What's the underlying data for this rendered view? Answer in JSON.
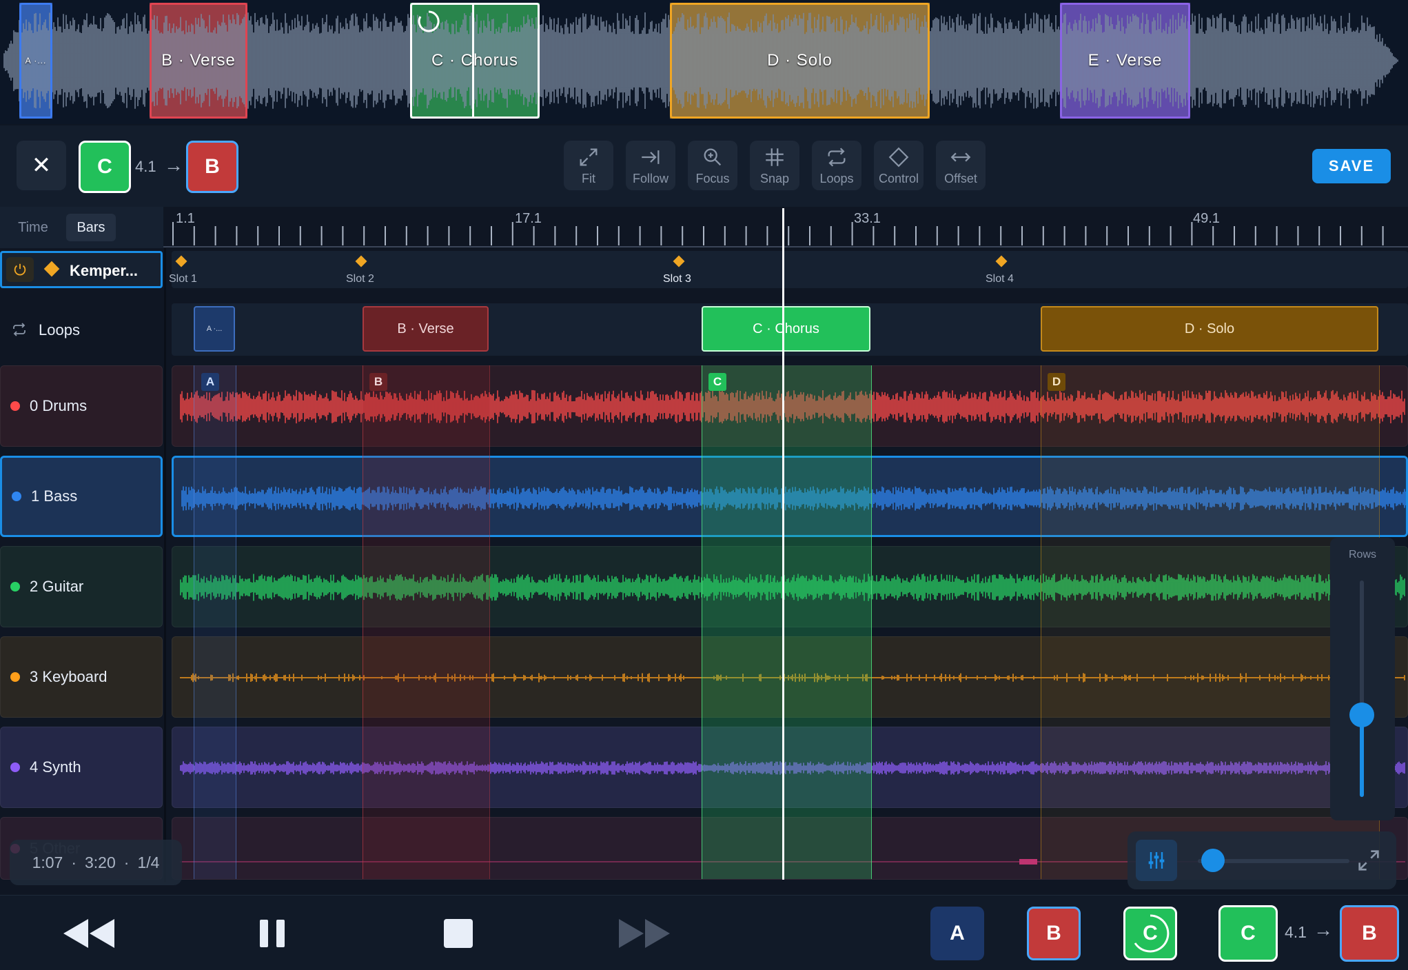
{
  "overview": {
    "sections": [
      {
        "label": "A ·...",
        "color": "#3b6fd1",
        "border": "#3d7bf0"
      },
      {
        "label": "B · Verse",
        "color": "#b8444d",
        "border": "#e04451"
      },
      {
        "label": "C · Chorus",
        "color": "#2f9d55",
        "border": "#ffffff"
      },
      {
        "label": "D · Solo",
        "color": "#b2893e",
        "border": "#f0a623"
      },
      {
        "label": "E · Verse",
        "color": "#7458c9",
        "border": "#8a63e6"
      }
    ]
  },
  "toolbar": {
    "close_label": "✕",
    "current_section": "C",
    "position": "4.1",
    "next_section": "B",
    "tools": [
      {
        "label": "Fit",
        "icon": "expand-icon"
      },
      {
        "label": "Follow",
        "icon": "follow-icon"
      },
      {
        "label": "Focus",
        "icon": "zoom-icon"
      },
      {
        "label": "Snap",
        "icon": "grid-icon"
      },
      {
        "label": "Loops",
        "icon": "loop-icon"
      },
      {
        "label": "Control",
        "icon": "diamond-icon"
      },
      {
        "label": "Offset",
        "icon": "offset-icon"
      }
    ],
    "save_label": "SAVE",
    "accent": "#1a8ee6"
  },
  "timeline": {
    "mode_tabs": [
      {
        "label": "Time",
        "active": false
      },
      {
        "label": "Bars",
        "active": true
      }
    ],
    "bar_labels": [
      "1.1",
      "17.1",
      "33.1",
      "49.1"
    ]
  },
  "control_row": {
    "name": "Kemper...",
    "slots": [
      "Slot 1",
      "Slot 2",
      "Slot 3",
      "Slot 4"
    ]
  },
  "loops_row": {
    "label": "Loops",
    "loops": [
      {
        "label": "A ·...",
        "color": "#1d3a6b"
      },
      {
        "label": "B · Verse",
        "color": "#6a2226"
      },
      {
        "label": "C · Chorus",
        "color": "#22c05a"
      },
      {
        "label": "D · Solo",
        "color": "#7a5209"
      }
    ]
  },
  "markers": [
    "A",
    "B",
    "C",
    "D"
  ],
  "tracks": [
    {
      "name": "0 Drums",
      "color": "#ff4a4a",
      "bg": "#2a1c27"
    },
    {
      "name": "1 Bass",
      "color": "#2f86f0",
      "bg": "#1c3356"
    },
    {
      "name": "2 Guitar",
      "color": "#28d064",
      "bg": "#17282a"
    },
    {
      "name": "3 Keyboard",
      "color": "#ff9f1a",
      "bg": "#2a2722"
    },
    {
      "name": "4 Synth",
      "color": "#8e5cf7",
      "bg": "#242747"
    },
    {
      "name": "5 Other",
      "color": "#ff3f8e",
      "bg": "#281d2d"
    }
  ],
  "rows_panel": {
    "label": "Rows",
    "level": 0.62
  },
  "time_readout": {
    "elapsed": "1:07",
    "total": "3:20",
    "fraction": "1/4"
  },
  "zoom_slider": {
    "level": 0.05
  },
  "transport": {
    "queue": [
      {
        "label": "A",
        "color": "#1c3769"
      },
      {
        "label": "B",
        "color": "#c23a3a"
      },
      {
        "label": "C",
        "color": "#22c05a"
      }
    ],
    "current": "C",
    "position": "4.1",
    "next": "B"
  }
}
